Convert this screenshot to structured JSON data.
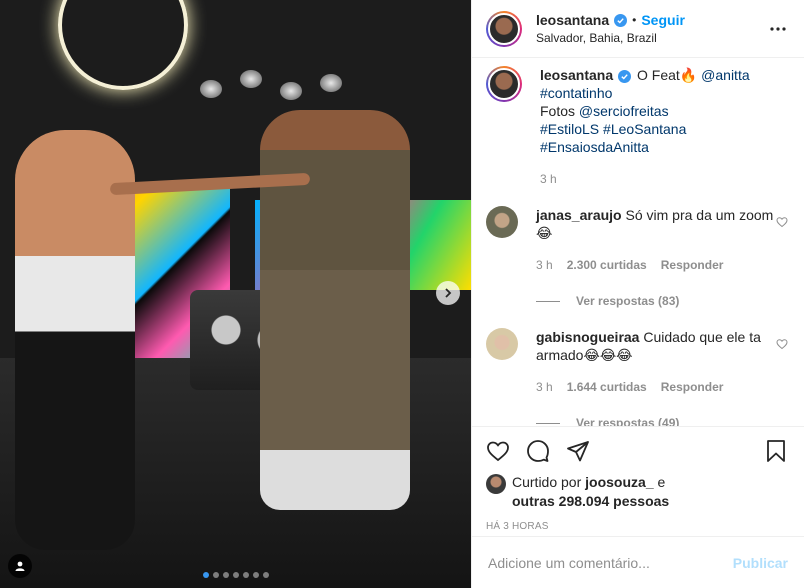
{
  "post": {
    "username": "leosantana",
    "follow_label": "Seguir",
    "separator": "•",
    "location": "Salvador, Bahia, Brazil",
    "more_icon": "more-horizontal-icon"
  },
  "caption": {
    "username": "leosantana",
    "text_part1": " O Feat🔥 ",
    "mention": "@anitta",
    "hashtag1": "#contatinho",
    "photos_prefix": "Fotos ",
    "photos_mention": "@serciofreitas",
    "hashtag2": "#EstiloLS",
    "hashtag3": "#LeoSantana",
    "hashtag4": "#EnsaiosdaAnitta",
    "time": "3 h"
  },
  "comments": [
    {
      "username": "janas_araujo",
      "text": " Só vim pra da um zoom😂",
      "time": "3 h",
      "likes": "2.300 curtidas",
      "reply_label": "Responder",
      "view_replies": "Ver respostas (83)"
    },
    {
      "username": "gabisnogueiraa",
      "text": " Cuidado que ele ta armado😂😂😂",
      "time": "3 h",
      "likes": "1.644 curtidas",
      "reply_label": "Responder",
      "view_replies": "Ver respostas (49)"
    }
  ],
  "likes": {
    "prefix": "Curtido por ",
    "user": "joosouza_",
    "joiner": " e",
    "others": "outras 298.094 pessoas"
  },
  "posted_ago": "HÁ 3 HORAS",
  "comment_box": {
    "placeholder": "Adicione um comentário...",
    "publish_label": "Publicar"
  },
  "carousel": {
    "slide_count": 7,
    "active_index": 0
  },
  "colors": {
    "accent": "#0095f6",
    "verified": "#3897f0",
    "text": "#262626",
    "muted": "#8e8e8e",
    "publish_disabled": "#b2dffc"
  }
}
